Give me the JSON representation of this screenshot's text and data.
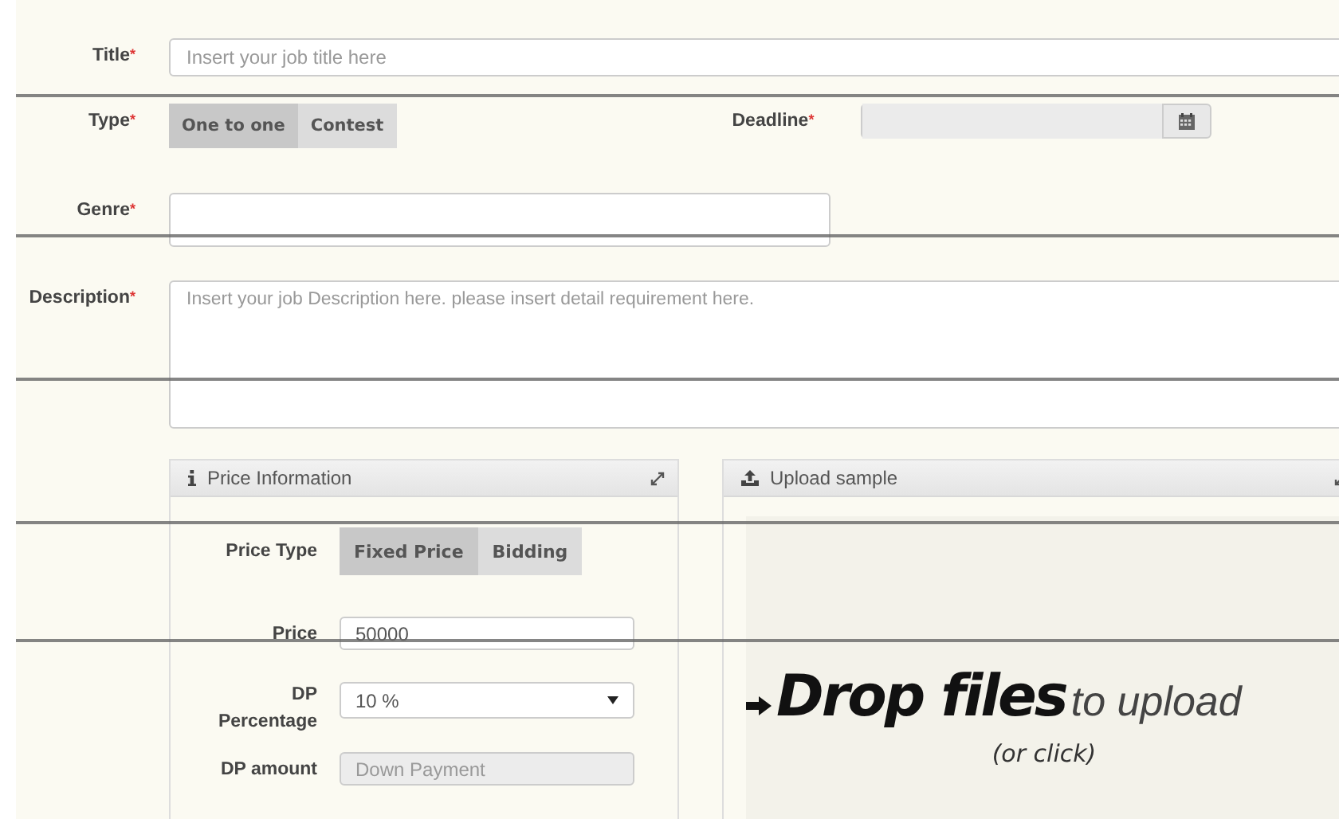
{
  "title_field": {
    "label": "Title",
    "mark": "*",
    "placeholder": "Insert your job title here"
  },
  "type_field": {
    "label": "Type",
    "mark": "*",
    "options": [
      {
        "label": "One to one",
        "selected": true
      },
      {
        "label": "Contest",
        "selected": false
      }
    ]
  },
  "deadline_field": {
    "label": "Deadline",
    "mark": "*"
  },
  "genre_field": {
    "label": "Genre",
    "mark": "*"
  },
  "description_field": {
    "label": "Description",
    "mark": "*",
    "placeholder": "Insert your job Description here. please insert detail requirement here."
  },
  "price_panel": {
    "title": "Price Information",
    "price_type": {
      "label": "Price Type",
      "options": [
        {
          "label": "Fixed Price",
          "selected": true
        },
        {
          "label": "Bidding",
          "selected": false
        }
      ]
    },
    "price": {
      "label": "Price",
      "value": "50000"
    },
    "dp_percentage": {
      "label": "DP Percentage",
      "value": "10 %"
    },
    "dp_amount": {
      "label": "DP amount",
      "placeholder": "Down Payment",
      "disabled": true
    }
  },
  "upload_panel": {
    "title": "Upload sample",
    "drop_bold": "Drop files",
    "drop_light": "to upload",
    "drop_hint": "(or click)"
  }
}
